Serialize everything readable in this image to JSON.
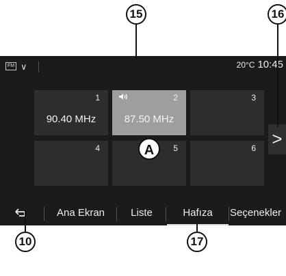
{
  "status": {
    "source_icon_label": "FM",
    "temperature": "20°C",
    "time": "10:45"
  },
  "presets": [
    {
      "number": "1",
      "frequency": "90.40 MHz",
      "selected": false
    },
    {
      "number": "2",
      "frequency": "87.50 MHz",
      "selected": true
    },
    {
      "number": "3",
      "frequency": "",
      "selected": false
    },
    {
      "number": "4",
      "frequency": "",
      "selected": false
    },
    {
      "number": "5",
      "frequency": "",
      "selected": false
    },
    {
      "number": "6",
      "frequency": "",
      "selected": false
    }
  ],
  "next_label": ">",
  "tabs": {
    "home": "Ana Ekran",
    "list": "Liste",
    "memory": "Hafıza",
    "options": "Seçenekler",
    "active": "memory"
  },
  "callouts": {
    "c15": "15",
    "c16": "16",
    "c10": "10",
    "c17": "17",
    "a": "A"
  },
  "icons": {
    "speaker": "speaker-icon",
    "back": "back-arrow-icon",
    "chevron": "chevron-down-icon"
  }
}
